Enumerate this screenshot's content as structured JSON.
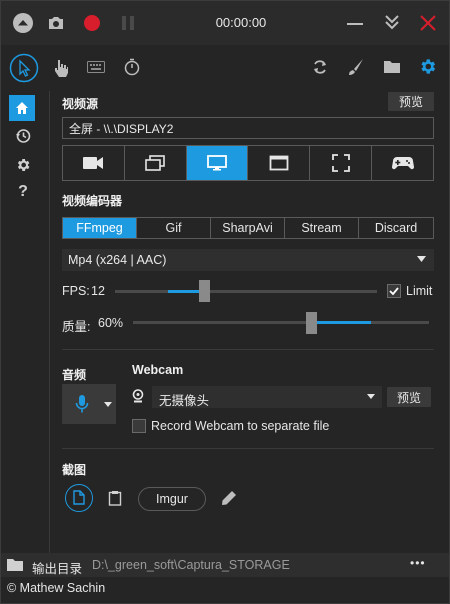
{
  "title_bar": {
    "timer": "00:00:00"
  },
  "video_source": {
    "header": "视频源",
    "preview_button": "预览",
    "source_value": "全屏 - \\\\.\\DISPLAY2",
    "source_modes": [
      "camera-icon",
      "window-icon",
      "monitor-icon",
      "region-icon",
      "fullscreen-icon",
      "gamepad-icon"
    ],
    "active_mode": "monitor-icon"
  },
  "video_encoder": {
    "header": "视频编码器",
    "tabs": [
      "FFmpeg",
      "Gif",
      "SharpAvi",
      "Stream",
      "Discard"
    ],
    "active_tab": "FFmpeg",
    "codec": "Mp4 (x264 | AAC)",
    "fps_label": "FPS:",
    "fps_value": "12",
    "fps_level": 0.34,
    "limit_label": "Limit",
    "limit_checked": true,
    "quality_label": "质量:",
    "quality_value": "60%",
    "quality_level": 0.6
  },
  "audio": {
    "header": "音频"
  },
  "webcam": {
    "header": "Webcam",
    "camera_value": "无摄像头",
    "preview_button": "预览",
    "separate_label": "Record Webcam to separate file"
  },
  "screenshot": {
    "header": "截图",
    "imgur_button": "Imgur"
  },
  "status_bar": {
    "label": "输出目录",
    "path": "D:\\_green_soft\\Captura_STORAGE",
    "more": "•••"
  },
  "footer": {
    "credit": "© Mathew Sachin"
  },
  "colors": {
    "accent": "#1e9ae0",
    "record": "#d81e2c",
    "background": "#252526"
  }
}
